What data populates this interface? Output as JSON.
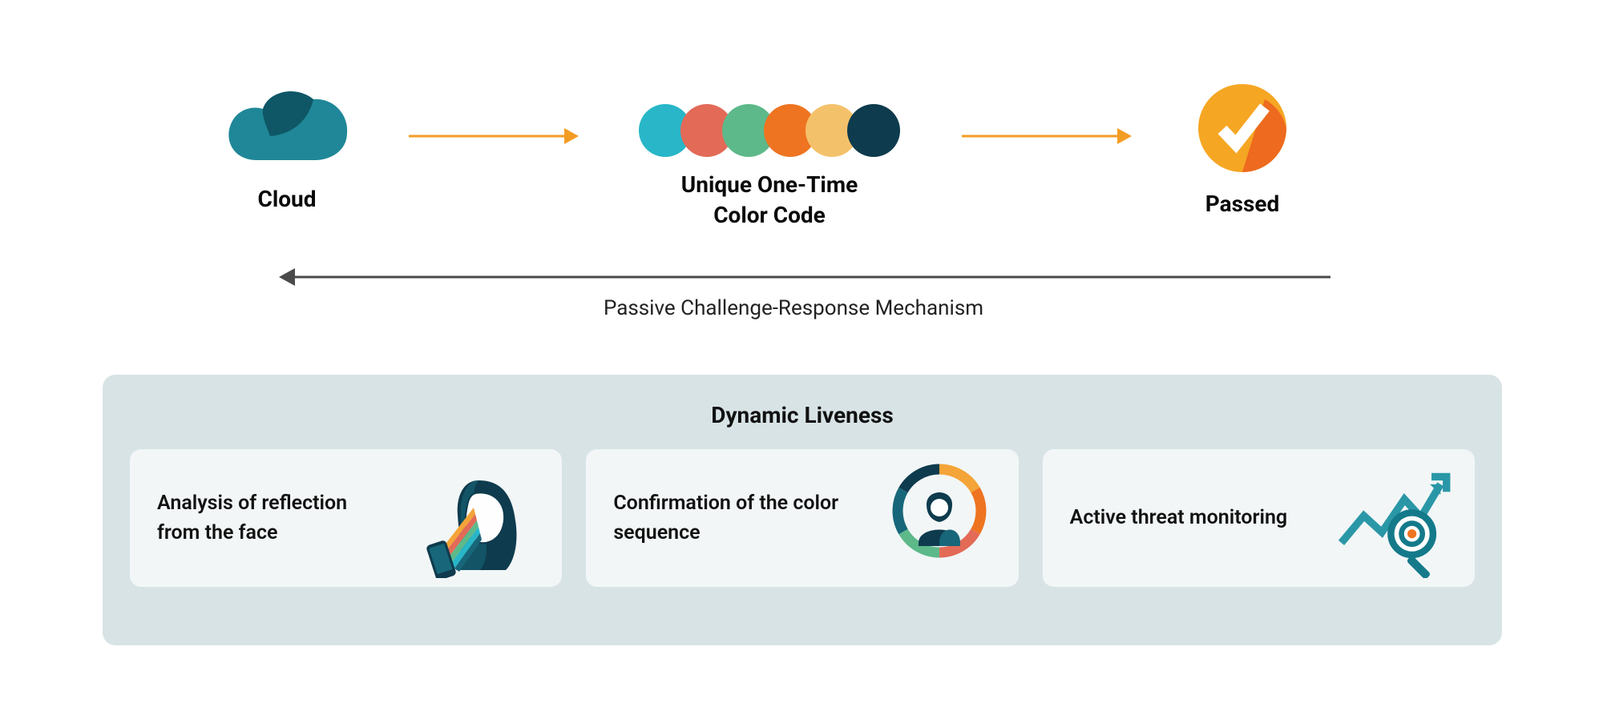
{
  "flow": {
    "cloud": {
      "label": "Cloud"
    },
    "colorCode": {
      "label_line1": "Unique One-Time",
      "label_line2": "Color Code",
      "dots": [
        "#28b6c8",
        "#e26a57",
        "#5db98a",
        "#ee7421",
        "#f4c16b",
        "#0e3b4d"
      ]
    },
    "passed": {
      "label": "Passed"
    }
  },
  "mechanism_label": "Passive Challenge-Response Mechanism",
  "panel": {
    "title": "Dynamic Liveness",
    "cards": [
      {
        "text": "Analysis of reflection from the face"
      },
      {
        "text": "Confirmation of the color sequence"
      },
      {
        "text": "Active threat monitoring"
      }
    ]
  }
}
